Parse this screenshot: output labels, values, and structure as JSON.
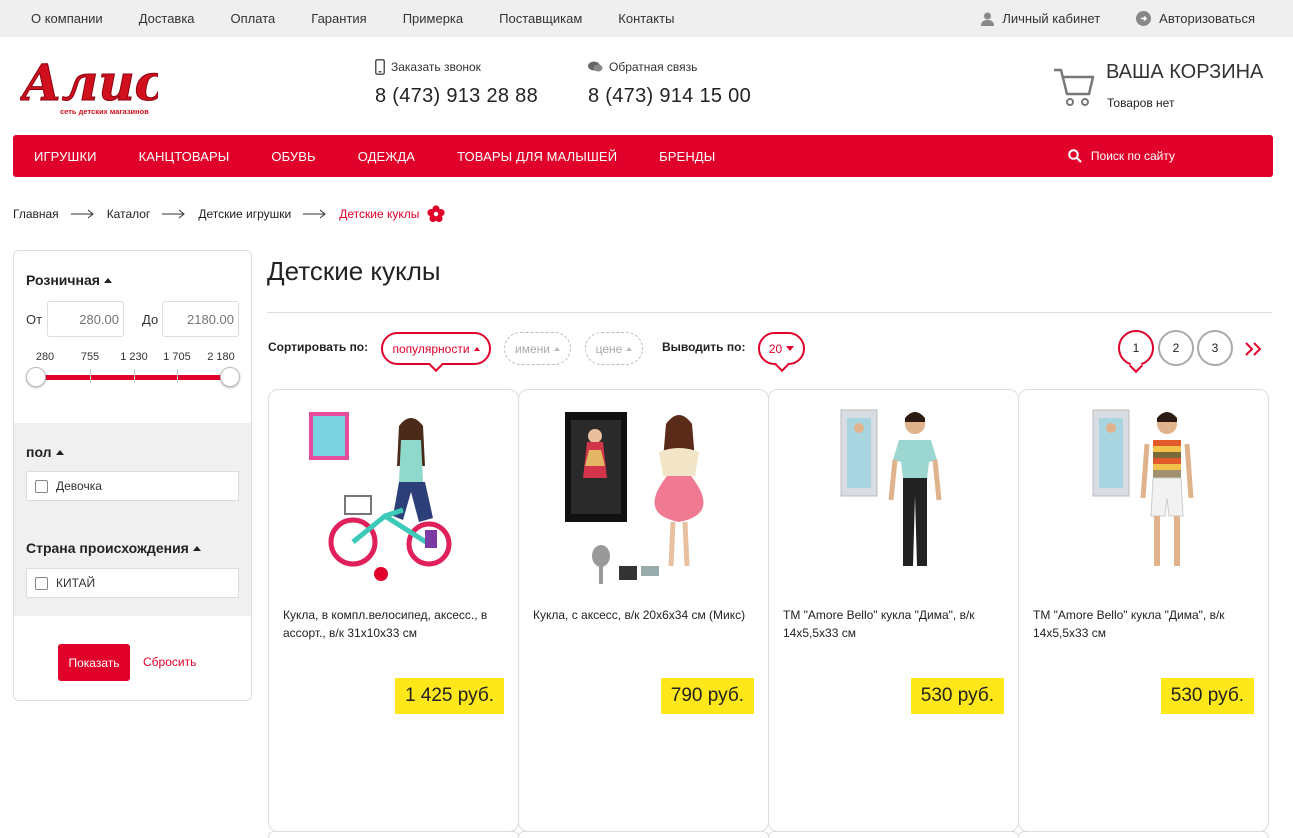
{
  "topbar": {
    "links": [
      "О компании",
      "Доставка",
      "Оплата",
      "Гарантия",
      "Примерка",
      "Поставщикам",
      "Контакты"
    ],
    "account": "Личный кабинет",
    "login": "Авторизоваться"
  },
  "header": {
    "logo": {
      "text": "Алиса",
      "tagline": "сеть детских магазинов"
    },
    "callback": {
      "label": "Заказать звонок",
      "phone": "8 (473) 913 28 88"
    },
    "feedback": {
      "label": "Обратная связь",
      "phone": "8 (473) 914 15 00"
    },
    "cart": {
      "title": "ВАША КОРЗИНА",
      "status": "Товаров нет"
    }
  },
  "mainnav": {
    "items": [
      "ИГРУШКИ",
      "КАНЦТОВАРЫ",
      "ОБУВЬ",
      "ОДЕЖДА",
      "ТОВАРЫ ДЛЯ МАЛЫШЕЙ",
      "БРЕНДЫ"
    ],
    "search": "Поиск по сайту"
  },
  "breadcrumb": [
    "Главная",
    "Каталог",
    "Детские игрушки",
    "Детские куклы"
  ],
  "filter": {
    "price": {
      "title": "Розничная",
      "from_label": "От",
      "to_label": "До",
      "from_placeholder": "280.00",
      "to_placeholder": "2180.00",
      "ticks": [
        "280",
        "755",
        "1 230",
        "1 705",
        "2 180"
      ],
      "range_min": 280,
      "range_max": 2180,
      "selected_min": 280,
      "selected_max": 2180
    },
    "gender": {
      "title": "пол",
      "option": "Девочка"
    },
    "country": {
      "title": "Страна происхождения",
      "option": "КИТАЙ"
    },
    "show_button": "Показать",
    "reset_link": "Сбросить"
  },
  "content": {
    "title": "Детские куклы",
    "sort_label": "Сортировать по:",
    "sort_options": [
      "популярности",
      "имени",
      "цене"
    ],
    "sort_active": "популярности",
    "perpage_label": "Выводить по:",
    "perpage_value": "20",
    "pages": [
      "1",
      "2",
      "3"
    ],
    "current_page": "1"
  },
  "products": [
    {
      "name": "Кукла, в компл.велосипед, аксесс., в ассорт., в/к 31х10х33 см",
      "price": "1 425 руб."
    },
    {
      "name": "Кукла, с аксесс, в/к 20х6х34 см (Микс)",
      "price": "790 руб."
    },
    {
      "name": "ТМ \"Amore Bello\" кукла \"Дима\", в/к 14х5,5х33 см",
      "price": "530 руб."
    },
    {
      "name": "ТМ \"Amore Bello\" кукла \"Дима\", в/к 14х5,5х33 см",
      "price": "530 руб."
    }
  ],
  "colors": {
    "accent": "#e0002a",
    "price_bg": "#ffe81a",
    "topbar_bg": "#efefef"
  }
}
